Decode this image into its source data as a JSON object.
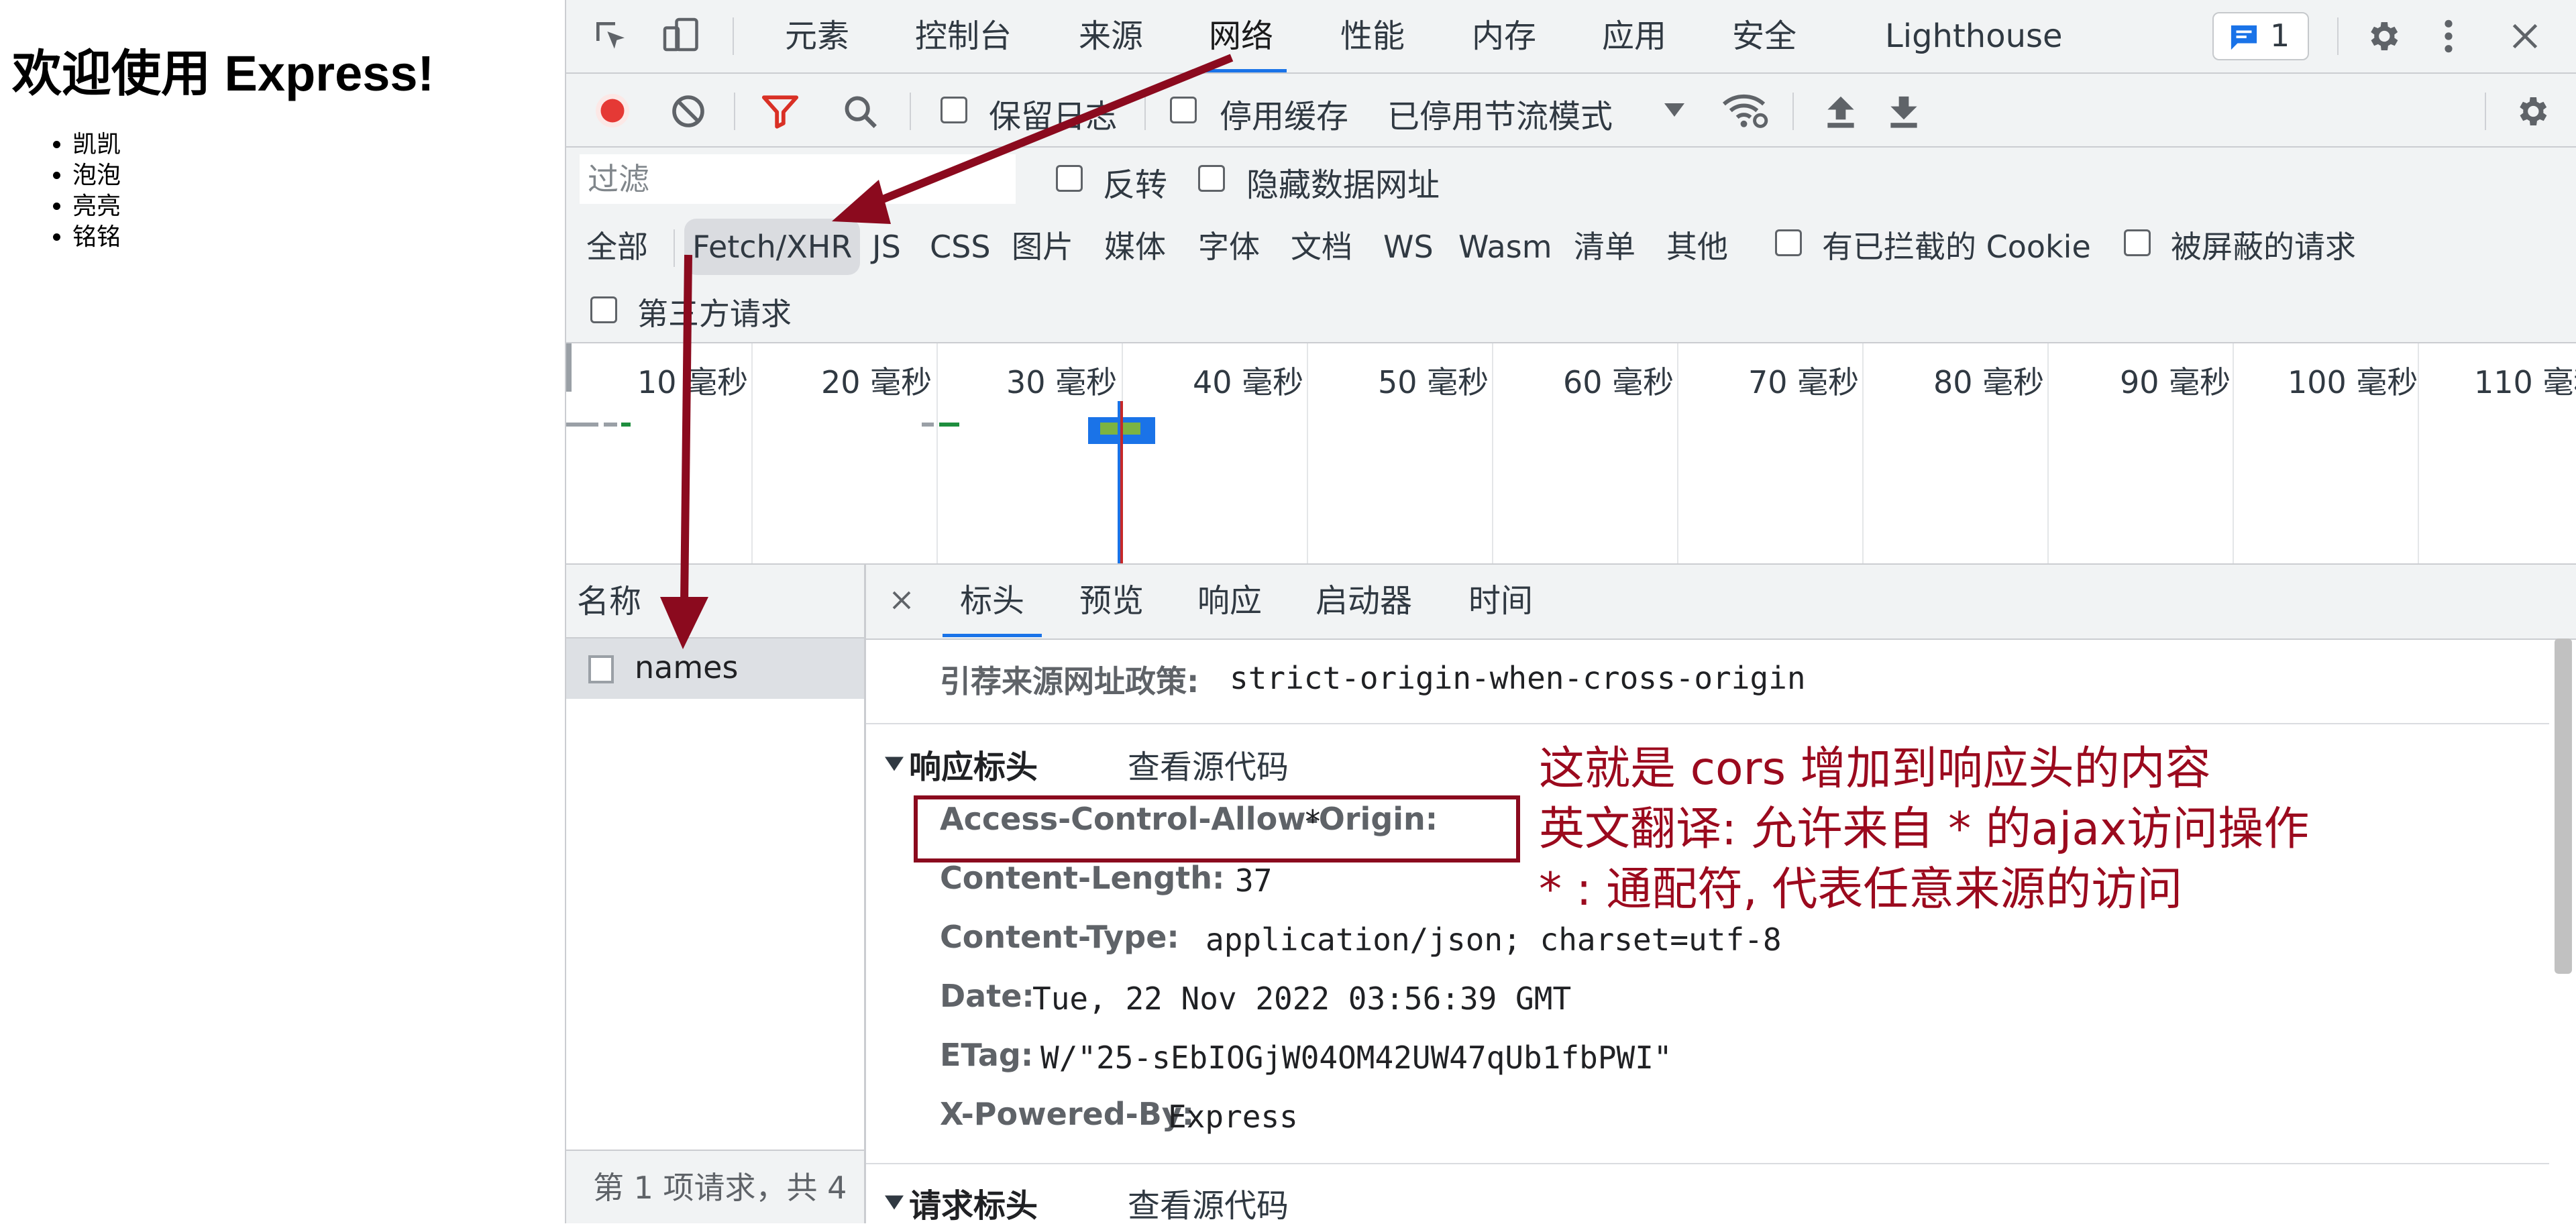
{
  "page": {
    "heading": "欢迎使用 Express!",
    "items": [
      "凯凯",
      "泡泡",
      "亮亮",
      "铭铭"
    ]
  },
  "devtools": {
    "panel_tabs": [
      "元素",
      "控制台",
      "来源",
      "网络",
      "性能",
      "内存",
      "应用",
      "安全",
      "Lighthouse"
    ],
    "active_panel": "网络",
    "issues_count": "1",
    "toolbar": {
      "preserve_log": "保留日志",
      "disable_cache": "停用缓存",
      "throttling": "已停用节流模式"
    },
    "filter": {
      "placeholder": "过滤",
      "invert": "反转",
      "hide_data_urls": "隐藏数据网址"
    },
    "types": [
      "全部",
      "Fetch/XHR",
      "JS",
      "CSS",
      "图片",
      "媒体",
      "字体",
      "文档",
      "WS",
      "Wasm",
      "清单",
      "其他"
    ],
    "active_type": "Fetch/XHR",
    "blocked_cookies": "有已拦截的 Cookie",
    "blocked_requests": "被屏蔽的请求",
    "third_party": "第三方请求",
    "timeline_ticks": [
      "10 毫秒",
      "20 毫秒",
      "30 毫秒",
      "40 毫秒",
      "50 毫秒",
      "60 毫秒",
      "70 毫秒",
      "80 毫秒",
      "90 毫秒",
      "100 毫秒",
      "110 毫秒"
    ],
    "names_header": "名称",
    "request_name": "names",
    "status": "第 1 项请求，共 4",
    "detail_tabs": [
      "标头",
      "预览",
      "响应",
      "启动器",
      "时间"
    ],
    "active_detail_tab": "标头",
    "referrer": {
      "key": "引荐来源网址政策:",
      "value": "strict-origin-when-cross-origin"
    },
    "response_headers_title": "响应标头",
    "view_source": "查看源代码",
    "response_headers": [
      {
        "key": "Access-Control-Allow-Origin:",
        "value": "*"
      },
      {
        "key": "Content-Length:",
        "value": "37"
      },
      {
        "key": "Content-Type:",
        "value": "application/json; charset=utf-8"
      },
      {
        "key": "Date:",
        "value": "Tue, 22 Nov 2022 03:56:39 GMT"
      },
      {
        "key": "ETag:",
        "value": "W/\"25-sEbIOGjW04OM42UW47qUb1fbPWI\""
      },
      {
        "key": "X-Powered-By:",
        "value": "Express"
      }
    ],
    "request_headers_title": "请求标头"
  },
  "annotations": [
    "这就是 cors 增加到响应头的内容",
    "英文翻译: 允许来自 * 的ajax访问操作",
    "* : 通配符, 代表任意来源的访问"
  ],
  "colors": {
    "annotation": "#9b0a1e",
    "accent": "#1a73e8",
    "record": "#e53935",
    "filter_icon": "#d93025"
  }
}
